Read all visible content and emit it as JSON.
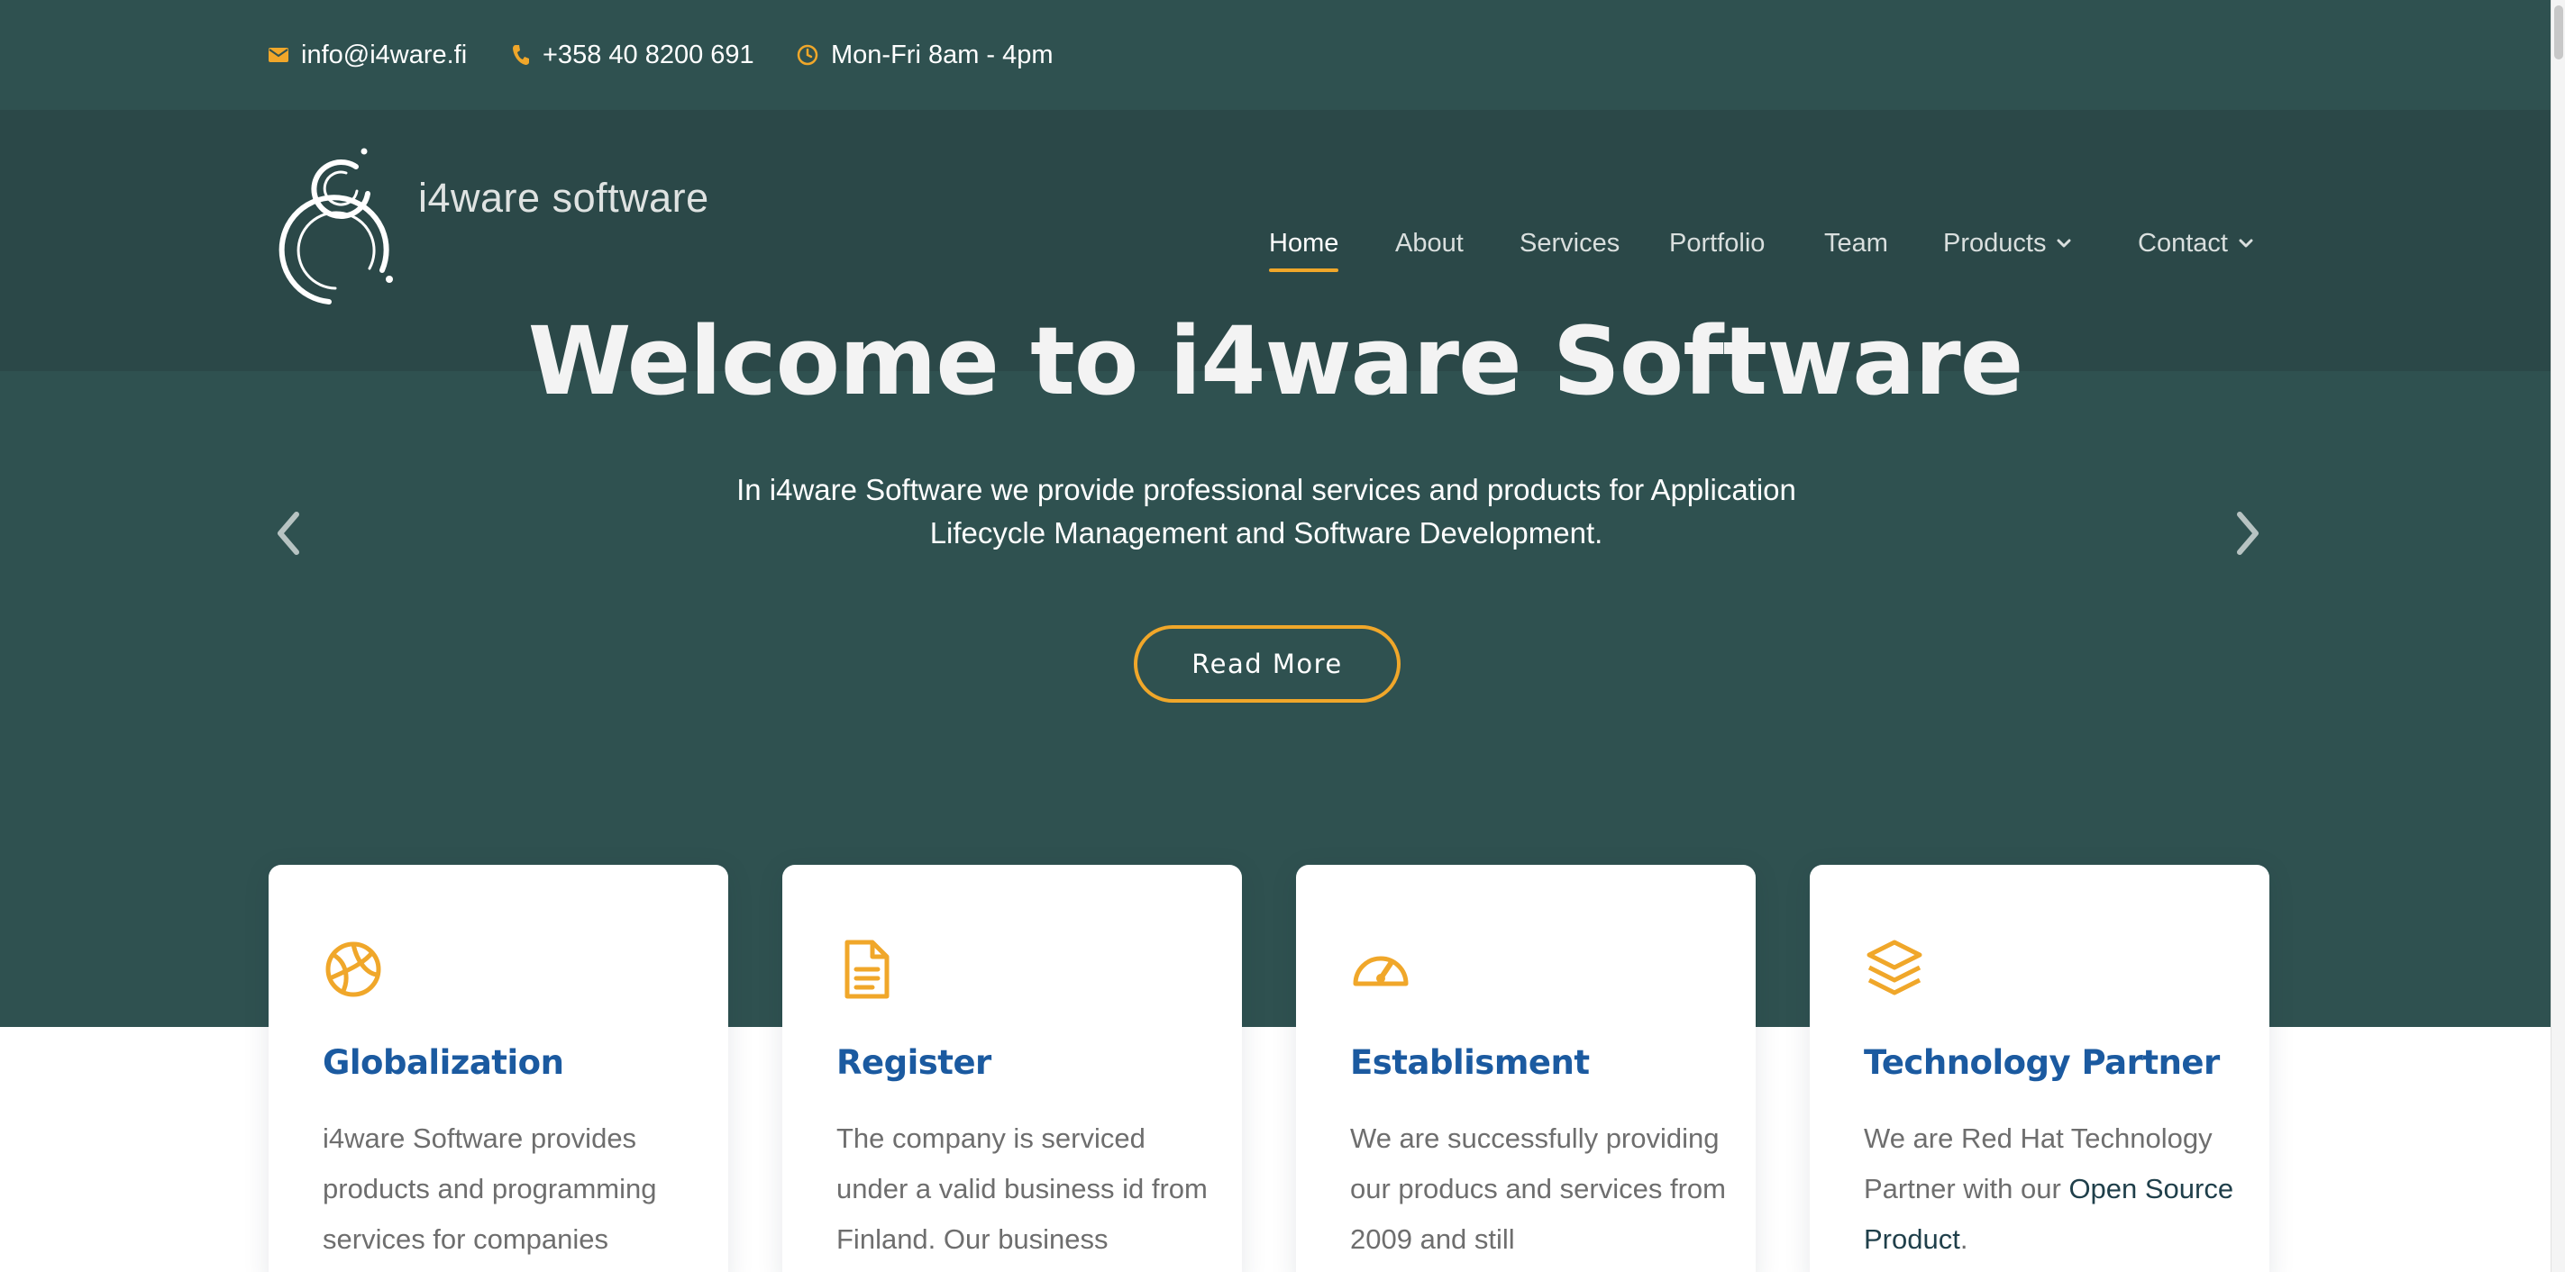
{
  "topbar": {
    "email": "info@i4ware.fi",
    "phone": "+358 40 8200 691",
    "hours": "Mon-Fri 8am - 4pm"
  },
  "brand": {
    "name": "i4ware software"
  },
  "nav": {
    "items": [
      {
        "label": "Home",
        "active": true
      },
      {
        "label": "About"
      },
      {
        "label": "Services"
      },
      {
        "label": "Portfolio"
      },
      {
        "label": "Team"
      },
      {
        "label": "Products",
        "dropdown": true
      },
      {
        "label": "Contact",
        "dropdown": true
      }
    ]
  },
  "hero": {
    "title": "Welcome to i4ware Software",
    "text": "In i4ware Software we provide professional services and products for Application Lifecycle Management and Software Development.",
    "button": "Read More"
  },
  "cards": [
    {
      "icon": "basketball-icon",
      "title": "Globalization",
      "text": "i4ware Software provides products and programming services for companies"
    },
    {
      "icon": "document-icon",
      "title": "Register",
      "text": "The company is serviced under a valid business id from Finland. Our business"
    },
    {
      "icon": "speedometer-icon",
      "title": "Establisment",
      "text": "We are successfully providing our producs and services from 2009 and still"
    },
    {
      "icon": "layers-icon",
      "title": "Technology Partner",
      "text_before": "We are Red Hat Technology Partner with our ",
      "link": "Open Source Product",
      "text_after": "."
    }
  ],
  "colors": {
    "hero_bg": "#2f5150",
    "header_band": "#2b4848",
    "accent": "#f0a72a",
    "card_title": "#1b5aa0",
    "card_text": "#6e6e6e"
  }
}
